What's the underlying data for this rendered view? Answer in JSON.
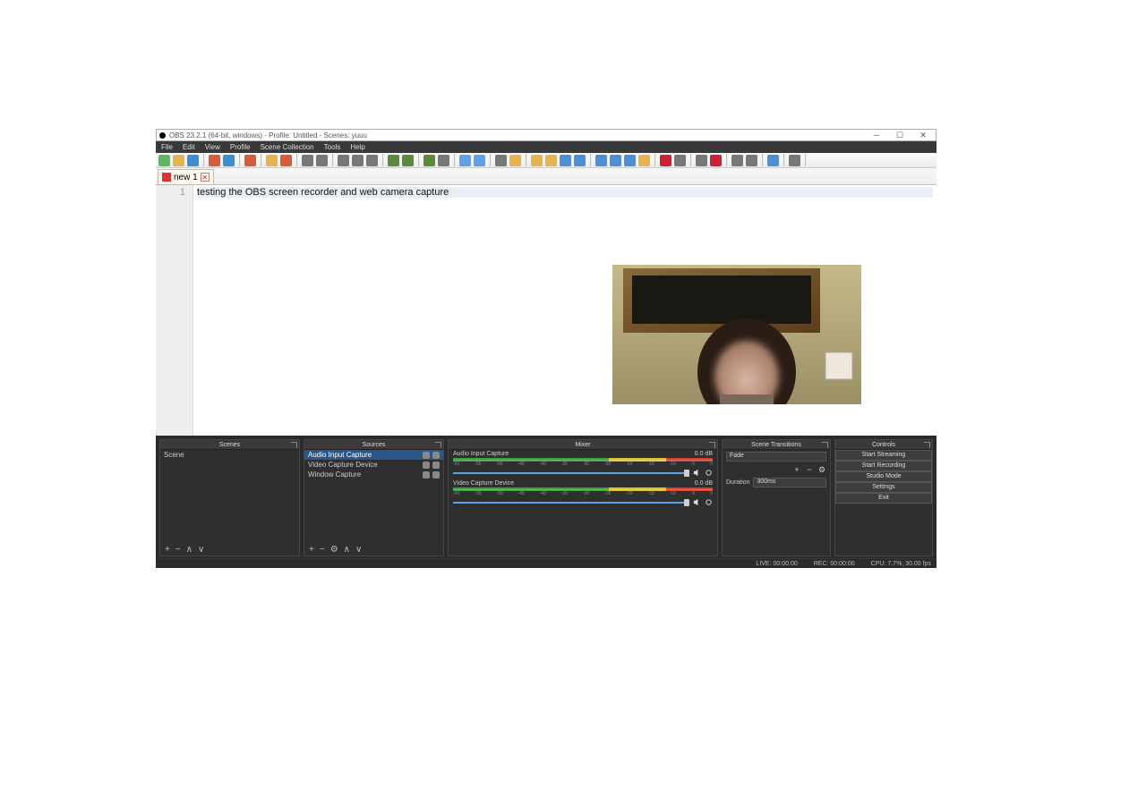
{
  "title": "OBS 23.2.1 (64-bit, windows) - Profile: Untitled - Scenes: yuuu",
  "menu": [
    "File",
    "Edit",
    "View",
    "Profile",
    "Scene Collection",
    "Tools",
    "Help"
  ],
  "editor": {
    "tab_name": "new 1",
    "line_number": "1",
    "line_text": "testing the OBS screen recorder and web camera capture"
  },
  "docks": {
    "scenes": {
      "title": "Scenes",
      "items": [
        "Scene"
      ]
    },
    "sources": {
      "title": "Sources",
      "items": [
        "Audio Input Capture",
        "Video Capture Device",
        "Window Capture"
      ],
      "selected": 0
    },
    "mixer": {
      "title": "Mixer",
      "channels": [
        {
          "name": "Audio Input Capture",
          "db": "0.0 dB"
        },
        {
          "name": "Video Capture Device",
          "db": "0.0 dB"
        }
      ],
      "ticks": [
        "-60",
        "-55",
        "-50",
        "-45",
        "-40",
        "-35",
        "-30",
        "-25",
        "-20",
        "-15",
        "-10",
        "-5",
        "0"
      ]
    },
    "transitions": {
      "title": "Scene Transitions",
      "type": "Fade",
      "duration_label": "Duration",
      "duration_value": "300ms"
    },
    "controls": {
      "title": "Controls",
      "buttons": [
        "Start Streaming",
        "Start Recording",
        "Studio Mode",
        "Settings",
        "Exit"
      ]
    }
  },
  "statusbar": {
    "live": "LIVE: 00:00:00",
    "rec": "REC: 00:00:00",
    "cpu": "CPU: 7.7%, 30.00 fps"
  },
  "toolbar_colors": [
    "#5cb85c",
    "#e8b34a",
    "#3a8fd4",
    "#d85c3a",
    "#3a8fd4",
    "#d85c3a",
    "#e8b34a",
    "#d85c3a",
    "#777",
    "#777",
    "#777",
    "#777",
    "#777",
    "#5b8a3a",
    "#5b8a3a",
    "#5b8a3a",
    "#777",
    "#5ca3e6",
    "#5ca3e6",
    "#777",
    "#e8b34a",
    "#e8b34a",
    "#e8b34a",
    "#4a90d4",
    "#4a90d4",
    "#4a90d4",
    "#4a90d4",
    "#4a90d4",
    "#e8b34a",
    "#c23",
    "#777",
    "#777",
    "#c23",
    "#777",
    "#777",
    "#4a90d4",
    "#777"
  ]
}
